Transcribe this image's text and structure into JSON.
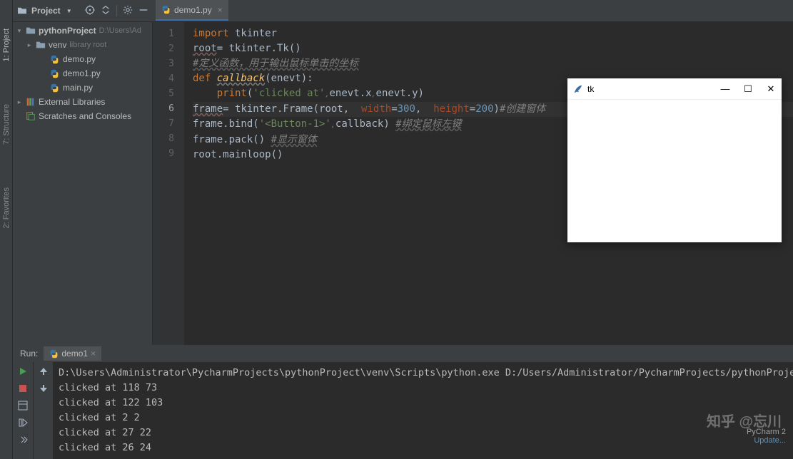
{
  "header": {
    "project_label": "Project"
  },
  "tabs": [
    {
      "label": "demo1.py"
    }
  ],
  "tree": {
    "root_name": "pythonProject",
    "root_path": "D:\\Users\\Ad",
    "venv_name": "venv",
    "venv_hint": "library root",
    "files": [
      "demo.py",
      "demo1.py",
      "main.py"
    ],
    "ext_lib": "External Libraries",
    "scratches": "Scratches and Consoles"
  },
  "code": {
    "lines": [
      {
        "n": 1,
        "html": "<span class='kw'>import</span> tkinter"
      },
      {
        "n": 2,
        "html": "<span class='wavy'>root</span>= tkinter.Tk()"
      },
      {
        "n": 3,
        "html": "<span class='cmt-u'>#定义函数，用于输出鼠标单击的坐标</span>"
      },
      {
        "n": 4,
        "html": "<span class='kw'>def </span><span class='fn'>callback</span>(enevt):"
      },
      {
        "n": 5,
        "html": "    <span class='kw'>print</span>(<span class='str'>'clicked at'</span><span class='sub-i'>,</span>enevt.x<span class='sub-i'>,</span>enevt.y)"
      },
      {
        "n": 6,
        "current": true,
        "html": "<span class='wavy'>frame</span>= tkinter.Frame(root,  <span class='param'>width</span>=<span class='num'>300</span>,  <span class='param'>height</span>=<span class='num'>200</span>)<span class='cmt'>#创建窗体</span>"
      },
      {
        "n": 7,
        "html": "frame.bind(<span class='str'>'&lt;Button-1&gt;'</span><span class='sub-i'>,</span>callback) <span class='cmt-u'>#绑定鼠标左键</span>"
      },
      {
        "n": 8,
        "html": "frame.pack() <span class='cmt-u'>#显示窗体</span>"
      },
      {
        "n": 9,
        "html": "root.mainloop()"
      }
    ]
  },
  "run": {
    "label": "Run:",
    "tab": "demo1",
    "path_line": "D:\\Users\\Administrator\\PycharmProjects\\pythonProject\\venv\\Scripts\\python.exe D:/Users/Administrator/PycharmProjects/pythonProject",
    "output": [
      "clicked at 118 73",
      "clicked at 122 103",
      "clicked at 2 2",
      "clicked at 27 22",
      "clicked at 26 24"
    ]
  },
  "tk": {
    "title": "tk"
  },
  "status": {
    "ide": "PyCharm 2",
    "update": "Update..."
  },
  "watermark": "知乎 @忘川",
  "left_bar": {
    "project": "1: Project",
    "structure": "7: Structure",
    "favorites": "2: Favorites"
  }
}
